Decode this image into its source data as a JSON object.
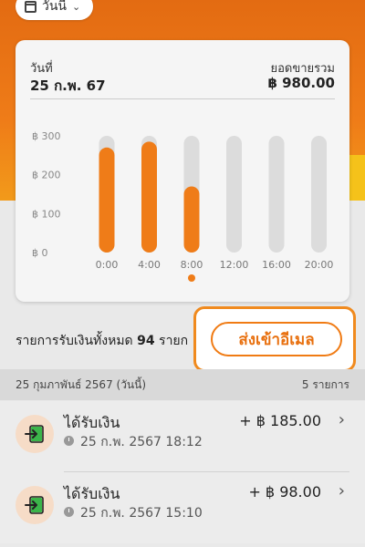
{
  "filter": {
    "label": "วันนี้",
    "calendar_icon": "calendar-icon",
    "chevron_icon": "chevron-down-icon"
  },
  "summary": {
    "date_label": "วันที่",
    "date_value": "25 ก.พ. 67",
    "total_label": "ยอดขายรวม",
    "total_value": "฿ 980.00"
  },
  "chart_data": {
    "type": "bar",
    "categories": [
      "0:00",
      "4:00",
      "8:00",
      "12:00",
      "16:00",
      "20:00"
    ],
    "values": [
      270,
      285,
      170,
      0,
      0,
      0
    ],
    "ylim": [
      0,
      300
    ],
    "yticks": [
      0,
      100,
      200,
      300
    ],
    "ytick_labels": [
      "฿ 0",
      "฿ 100",
      "฿ 200",
      "฿ 300"
    ],
    "selected_index": 2,
    "bar_color": "#ef7c18",
    "track_color": "#dcdcdc",
    "grid": false
  },
  "list": {
    "total_prefix": "รายการรับเงินทั้งหมด",
    "total_count": "94",
    "total_suffix": "รายก",
    "email_button": "ส่งเข้าอีเมล"
  },
  "section": {
    "date": "25 กุมภาพันธ์ 2567 (วันนี้)",
    "count": "5 รายการ"
  },
  "transactions": [
    {
      "title": "ได้รับเงิน",
      "time": "25 ก.พ. 2567 18:12",
      "amount": "+ ฿ 185.00",
      "icon": "receive-money-icon"
    },
    {
      "title": "ได้รับเงิน",
      "time": "25 ก.พ. 2567 15:10",
      "amount": "+ ฿ 98.00",
      "icon": "receive-money-icon"
    }
  ],
  "colors": {
    "accent": "#ef7c18",
    "accent_dark": "#e36b12",
    "icon_green": "#2ea043"
  }
}
